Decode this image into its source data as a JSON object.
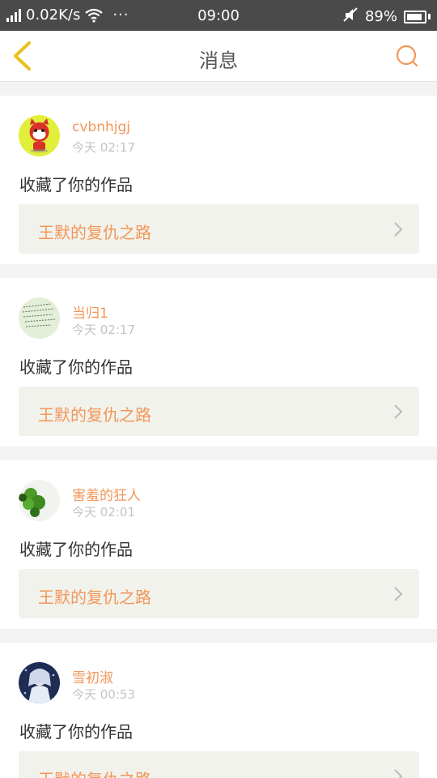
{
  "status_bar": {
    "speed": "0.02K/s",
    "dots": "···",
    "time": "09:00",
    "battery": "89%",
    "battery_level": 0.89
  },
  "header": {
    "title": "消息",
    "back_icon": "chevron-left-icon",
    "search_icon": "search-icon"
  },
  "colors": {
    "accent": "#f2975a",
    "back_icon": "#e8c21f",
    "card_link_bg": "#f2f2ec"
  },
  "messages": [
    {
      "user": "cvbnhjgj",
      "time": "今天 02:17",
      "action": "收藏了你的作品",
      "work": "王默的复仇之路"
    },
    {
      "user": "当归1",
      "time": "今天 02:17",
      "action": "收藏了你的作品",
      "work": "王默的复仇之路"
    },
    {
      "user": "害羞的狂人",
      "time": "今天 02:01",
      "action": "收藏了你的作品",
      "work": "王默的复仇之路"
    },
    {
      "user": "雪初淑",
      "time": "今天 00:53",
      "action": "收藏了你的作品",
      "work": "王默的复仇之路"
    }
  ]
}
